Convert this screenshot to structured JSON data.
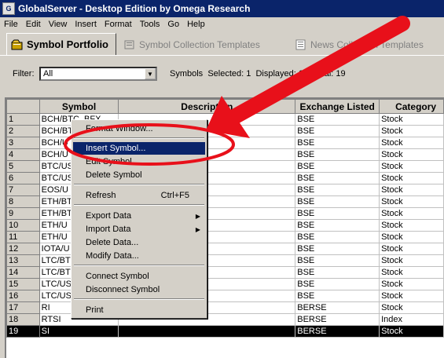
{
  "window": {
    "title": "GlobalServer - Desktop Edition by Omega Research"
  },
  "menu": [
    "File",
    "Edit",
    "View",
    "Insert",
    "Format",
    "Tools",
    "Go",
    "Help"
  ],
  "tabs": [
    {
      "label": "Symbol Portfolio",
      "icon": "portfolio-icon",
      "active": true
    },
    {
      "label": "Symbol Collection Templates",
      "icon": "collection-icon",
      "active": false
    },
    {
      "label": "News Collection Templates",
      "icon": "news-icon",
      "active": false
    }
  ],
  "filter": {
    "label": "Filter:",
    "value": "All",
    "status_prefix": "Symbols",
    "selected_label": "Selected: 1",
    "displayed_label": "Displayed: 19",
    "total_label": "Total: 19"
  },
  "grid": {
    "headers": [
      "",
      "Symbol",
      "Description",
      "Exchange Listed",
      "Category"
    ],
    "rows": [
      {
        "n": "1",
        "symbol": "BCH/BTC_BFX",
        "desc": "",
        "exch": "BSE",
        "cat": "Stock"
      },
      {
        "n": "2",
        "symbol": "BCH/BT",
        "desc": "",
        "exch": "BSE",
        "cat": "Stock"
      },
      {
        "n": "3",
        "symbol": "BCH/U",
        "desc": "",
        "exch": "BSE",
        "cat": "Stock"
      },
      {
        "n": "4",
        "symbol": "BCH/U",
        "desc": "",
        "exch": "BSE",
        "cat": "Stock"
      },
      {
        "n": "5",
        "symbol": "BTC/US",
        "desc": "",
        "exch": "BSE",
        "cat": "Stock"
      },
      {
        "n": "6",
        "symbol": "BTC/US",
        "desc": "",
        "exch": "BSE",
        "cat": "Stock"
      },
      {
        "n": "7",
        "symbol": "EOS/U",
        "desc": "",
        "exch": "BSE",
        "cat": "Stock"
      },
      {
        "n": "8",
        "symbol": "ETH/BT",
        "desc": "",
        "exch": "BSE",
        "cat": "Stock"
      },
      {
        "n": "9",
        "symbol": "ETH/BT",
        "desc": "",
        "exch": "BSE",
        "cat": "Stock"
      },
      {
        "n": "10",
        "symbol": "ETH/U",
        "desc": "",
        "exch": "BSE",
        "cat": "Stock"
      },
      {
        "n": "11",
        "symbol": "ETH/U",
        "desc": "",
        "exch": "BSE",
        "cat": "Stock"
      },
      {
        "n": "12",
        "symbol": "IOTA/U",
        "desc": "",
        "exch": "BSE",
        "cat": "Stock"
      },
      {
        "n": "13",
        "symbol": "LTC/BT",
        "desc": "",
        "exch": "BSE",
        "cat": "Stock"
      },
      {
        "n": "14",
        "symbol": "LTC/BT",
        "desc": "",
        "exch": "BSE",
        "cat": "Stock"
      },
      {
        "n": "15",
        "symbol": "LTC/US",
        "desc": "",
        "exch": "BSE",
        "cat": "Stock"
      },
      {
        "n": "16",
        "symbol": "LTC/US",
        "desc": "",
        "exch": "BSE",
        "cat": "Stock"
      },
      {
        "n": "17",
        "symbol": "RI",
        "desc": "",
        "exch": "BERSE",
        "cat": "Stock"
      },
      {
        "n": "18",
        "symbol": "RTSI",
        "desc": "",
        "exch": "BERSE",
        "cat": "Index"
      },
      {
        "n": "19",
        "symbol": "SI",
        "desc": "",
        "exch": "BERSE",
        "cat": "Stock",
        "selected": true
      }
    ]
  },
  "context_menu": {
    "items": [
      {
        "label": "Format Window...",
        "shortcut": "",
        "submenu": false
      },
      {
        "label": "Insert Symbol...",
        "shortcut": "",
        "submenu": false,
        "highlighted": true
      },
      {
        "label": "Edit Symbol...",
        "shortcut": "",
        "submenu": false
      },
      {
        "label": "Delete Symbol",
        "shortcut": "",
        "submenu": false
      },
      {
        "label": "Refresh",
        "shortcut": "Ctrl+F5",
        "submenu": false
      },
      {
        "label": "Export Data",
        "shortcut": "",
        "submenu": true
      },
      {
        "label": "Import Data",
        "shortcut": "",
        "submenu": true
      },
      {
        "label": "Delete Data...",
        "shortcut": "",
        "submenu": false
      },
      {
        "label": "Modify Data...",
        "shortcut": "",
        "submenu": false
      },
      {
        "label": "Connect Symbol",
        "shortcut": "",
        "submenu": false
      },
      {
        "label": "Disconnect Symbol",
        "shortcut": "",
        "submenu": false
      },
      {
        "label": "Print",
        "shortcut": "",
        "submenu": false
      }
    ]
  },
  "annotation": {
    "color": "#e8101a"
  },
  "colors": {
    "titlebar": "#0a246a",
    "highlight": "#0a246a",
    "face": "#d4d0c8"
  }
}
